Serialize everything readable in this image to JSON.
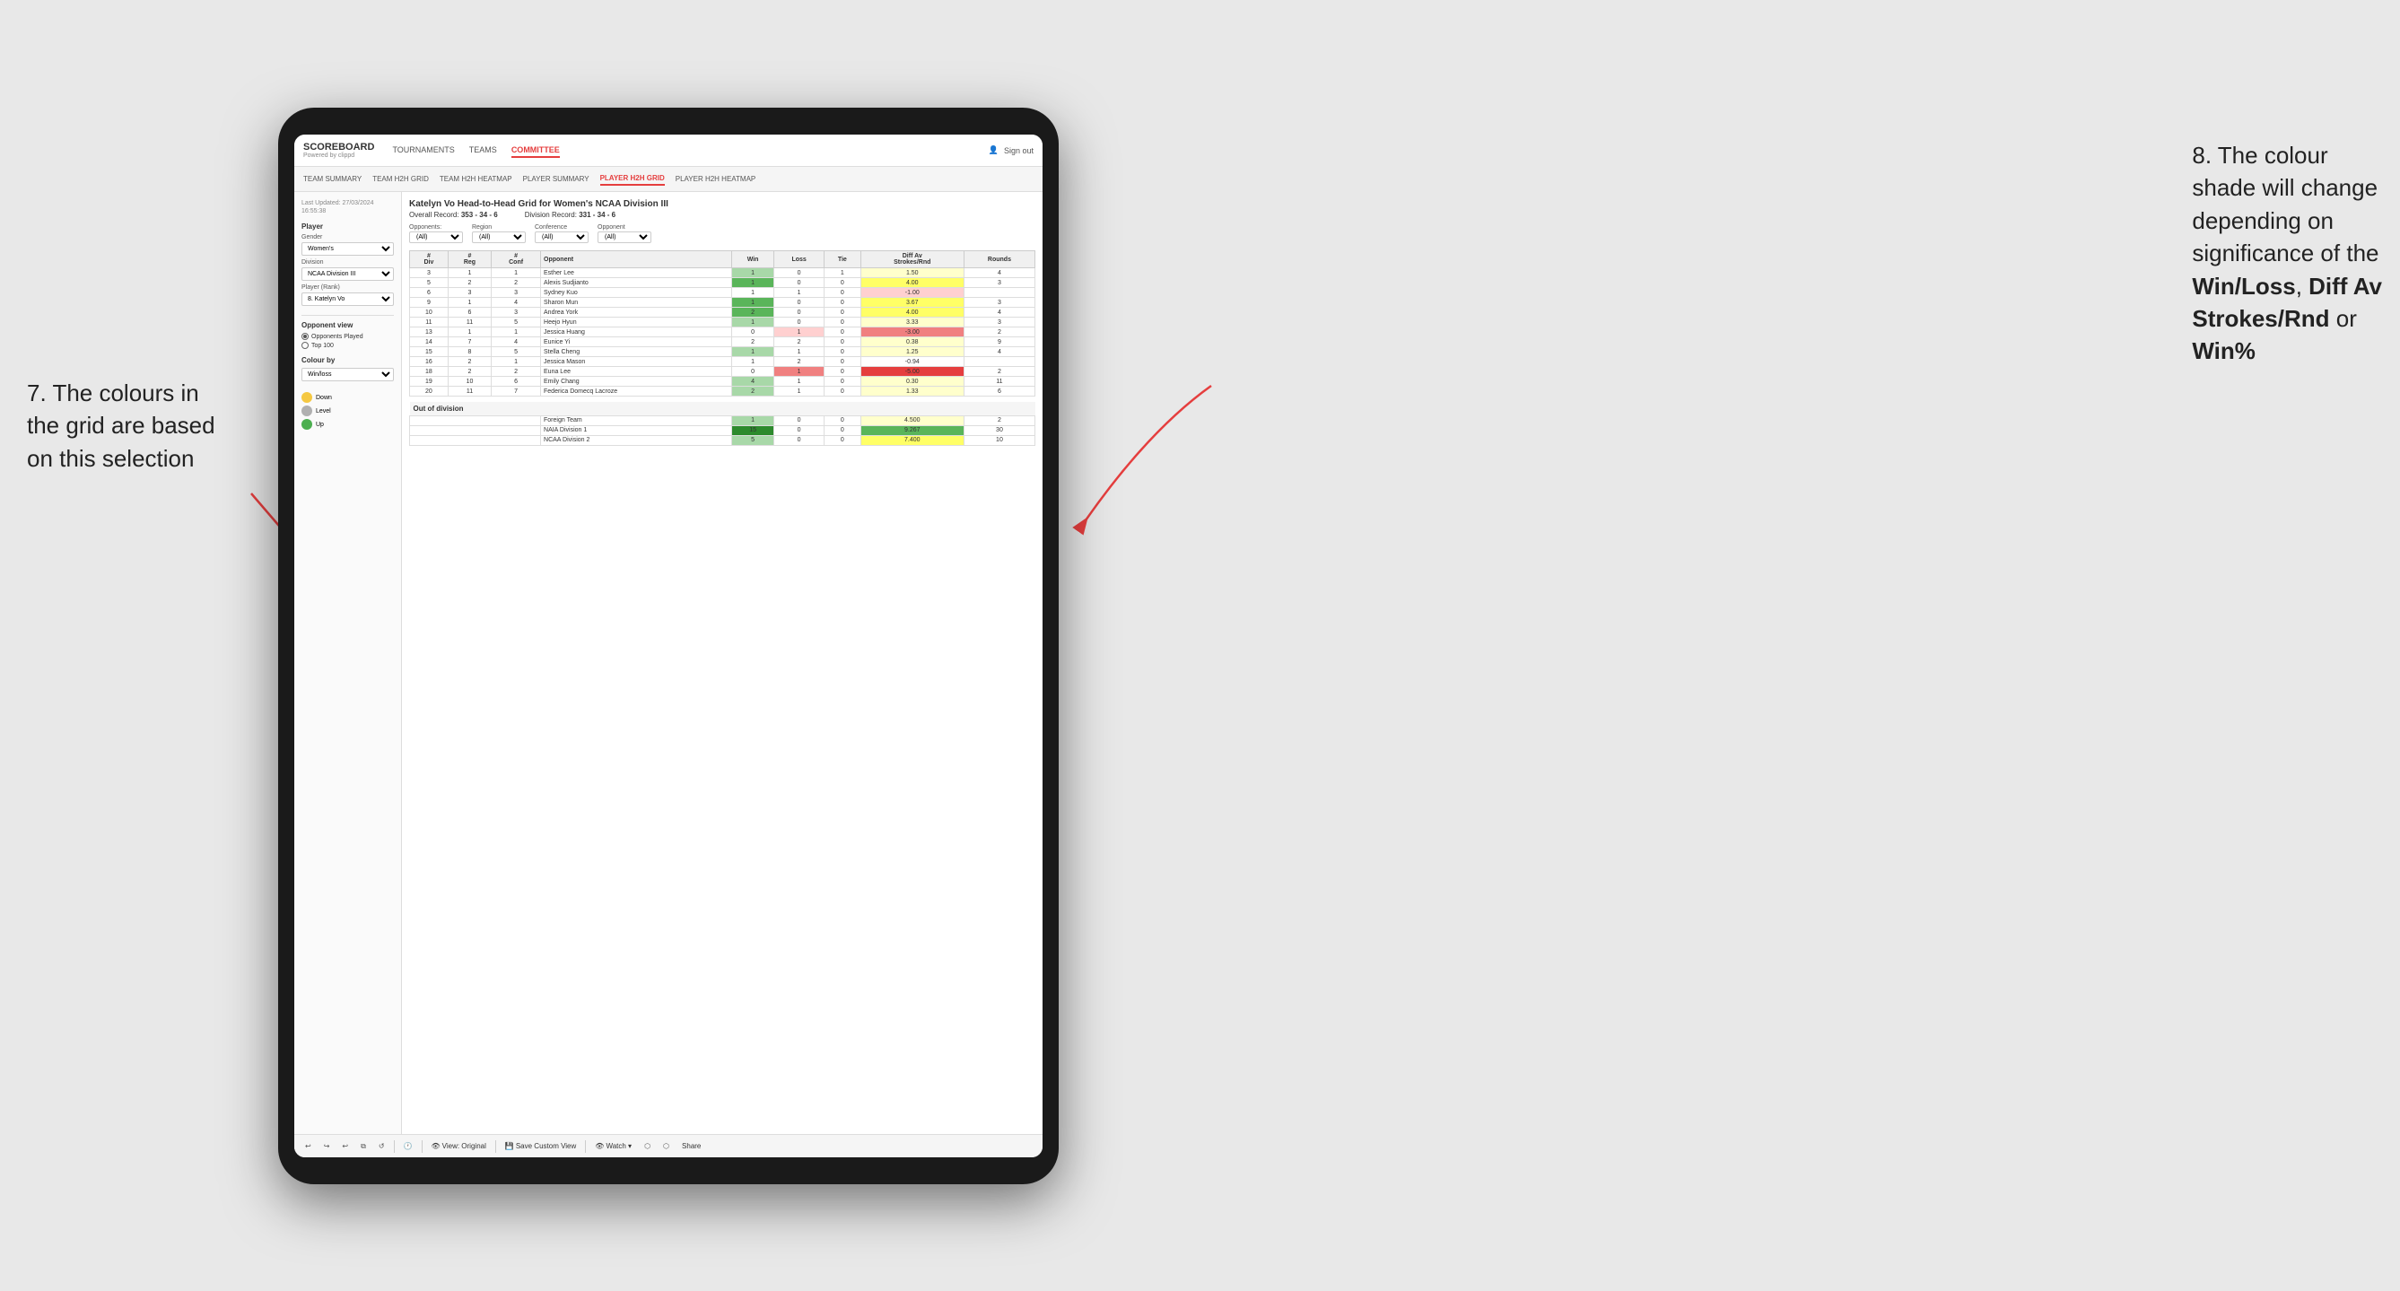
{
  "annotations": {
    "left": {
      "line1": "7. The colours in",
      "line2": "the grid are based",
      "line3": "on this selection"
    },
    "right": {
      "line1": "8. The colour",
      "line2": "shade will change",
      "line3": "depending on",
      "line4": "significance of the",
      "bold1": "Win/Loss",
      "comma1": ", ",
      "bold2": "Diff Av",
      "line5": "Strokes/Rnd",
      "or": " or",
      "bold3": "Win%"
    }
  },
  "header": {
    "logo": "SCOREBOARD",
    "logo_sub": "Powered by clippd",
    "nav": [
      "TOURNAMENTS",
      "TEAMS",
      "COMMITTEE"
    ],
    "active_nav": "COMMITTEE",
    "right_items": [
      "Sign out"
    ],
    "subnav": [
      "TEAM SUMMARY",
      "TEAM H2H GRID",
      "TEAM H2H HEATMAP",
      "PLAYER SUMMARY",
      "PLAYER H2H GRID",
      "PLAYER H2H HEATMAP"
    ],
    "active_subnav": "PLAYER H2H GRID"
  },
  "left_panel": {
    "last_updated": "Last Updated: 27/03/2024\n16:55:38",
    "player_label": "Player",
    "gender_label": "Gender",
    "gender_value": "Women's",
    "division_label": "Division",
    "division_value": "NCAA Division III",
    "player_rank_label": "Player (Rank)",
    "player_rank_value": "8. Katelyn Vo",
    "opponent_view_label": "Opponent view",
    "opponent_view_options": [
      "Opponents Played",
      "Top 100"
    ],
    "opponent_view_selected": "Opponents Played",
    "colour_by_label": "Colour by",
    "colour_by_value": "Win/loss",
    "legend": [
      {
        "label": "Down",
        "color": "#f5c842"
      },
      {
        "label": "Level",
        "color": "#b0b0b0"
      },
      {
        "label": "Up",
        "color": "#4caf50"
      }
    ]
  },
  "grid": {
    "title": "Katelyn Vo Head-to-Head Grid for Women's NCAA Division III",
    "overall_record_label": "Overall Record:",
    "overall_record_value": "353 - 34 - 6",
    "division_record_label": "Division Record:",
    "division_record_value": "331 - 34 - 6",
    "filter_labels": [
      "Opponents:",
      "Region",
      "Conference",
      "Opponent"
    ],
    "filter_values": [
      "(All)",
      "(All)",
      "(All)",
      "(All)"
    ],
    "columns": [
      "#\nDiv",
      "#\nReg",
      "#\nConf",
      "Opponent",
      "Win",
      "Loss",
      "Tie",
      "Diff Av\nStrokes/Rnd",
      "Rounds"
    ],
    "rows": [
      {
        "div": "3",
        "reg": "1",
        "conf": "1",
        "opponent": "Esther Lee",
        "win": 1,
        "loss": 0,
        "tie": 1,
        "diff": "1.50",
        "rounds": "4",
        "win_color": "win-light",
        "diff_color": "yellow-light"
      },
      {
        "div": "5",
        "reg": "2",
        "conf": "2",
        "opponent": "Alexis Sudjianto",
        "win": 1,
        "loss": 0,
        "tie": 0,
        "diff": "4.00",
        "rounds": "3",
        "win_color": "win-medium",
        "diff_color": "yellow-medium"
      },
      {
        "div": "6",
        "reg": "3",
        "conf": "3",
        "opponent": "Sydney Kuo",
        "win": 1,
        "loss": 1,
        "tie": 0,
        "diff": "-1.00",
        "rounds": "",
        "win_color": "neutral",
        "diff_color": "loss-light"
      },
      {
        "div": "9",
        "reg": "1",
        "conf": "4",
        "opponent": "Sharon Mun",
        "win": 1,
        "loss": 0,
        "tie": 0,
        "diff": "3.67",
        "rounds": "3",
        "win_color": "win-medium",
        "diff_color": "yellow-medium"
      },
      {
        "div": "10",
        "reg": "6",
        "conf": "3",
        "opponent": "Andrea York",
        "win": 2,
        "loss": 0,
        "tie": 0,
        "diff": "4.00",
        "rounds": "4",
        "win_color": "win-medium",
        "diff_color": "yellow-medium"
      },
      {
        "div": "11",
        "reg": "11",
        "conf": "5",
        "opponent": "Heejo Hyun",
        "win": 1,
        "loss": 0,
        "tie": 0,
        "diff": "3.33",
        "rounds": "3",
        "win_color": "win-light",
        "diff_color": "yellow-light"
      },
      {
        "div": "13",
        "reg": "1",
        "conf": "1",
        "opponent": "Jessica Huang",
        "win": 0,
        "loss": 1,
        "tie": 0,
        "diff": "-3.00",
        "rounds": "2",
        "win_color": "neutral",
        "diff_color": "loss-medium"
      },
      {
        "div": "14",
        "reg": "7",
        "conf": "4",
        "opponent": "Eunice Yi",
        "win": 2,
        "loss": 2,
        "tie": 0,
        "diff": "0.38",
        "rounds": "9",
        "win_color": "neutral",
        "diff_color": "yellow-light"
      },
      {
        "div": "15",
        "reg": "8",
        "conf": "5",
        "opponent": "Stella Cheng",
        "win": 1,
        "loss": 1,
        "tie": 0,
        "diff": "1.25",
        "rounds": "4",
        "win_color": "neutral",
        "diff_color": "yellow-light"
      },
      {
        "div": "16",
        "reg": "2",
        "conf": "1",
        "opponent": "Jessica Mason",
        "win": 1,
        "loss": 2,
        "tie": 0,
        "diff": "-0.94",
        "rounds": "",
        "win_color": "neutral",
        "diff_color": "neutral"
      },
      {
        "div": "18",
        "reg": "2",
        "conf": "2",
        "opponent": "Euna Lee",
        "win": 0,
        "loss": 1,
        "tie": 0,
        "diff": "-5.00",
        "rounds": "2",
        "win_color": "neutral",
        "diff_color": "loss-strong"
      },
      {
        "div": "19",
        "reg": "10",
        "conf": "6",
        "opponent": "Emily Chang",
        "win": 4,
        "loss": 1,
        "tie": 0,
        "diff": "0.30",
        "rounds": "11",
        "win_color": "win-light",
        "diff_color": "yellow-light"
      },
      {
        "div": "20",
        "reg": "11",
        "conf": "7",
        "opponent": "Federica Domecq Lacroze",
        "win": 2,
        "loss": 1,
        "tie": 0,
        "diff": "1.33",
        "rounds": "6",
        "win_color": "win-light",
        "diff_color": "yellow-light"
      }
    ],
    "out_of_division_label": "Out of division",
    "out_of_division_rows": [
      {
        "opponent": "Foreign Team",
        "win": 1,
        "loss": 0,
        "tie": 0,
        "diff": "4.500",
        "rounds": "2",
        "win_color": "win-light",
        "diff_color": "yellow-light"
      },
      {
        "opponent": "NAIA Division 1",
        "win": 15,
        "loss": 0,
        "tie": 0,
        "diff": "9.267",
        "rounds": "30",
        "win_color": "win-strong",
        "diff_color": "win-medium"
      },
      {
        "opponent": "NCAA Division 2",
        "win": 5,
        "loss": 0,
        "tie": 0,
        "diff": "7.400",
        "rounds": "10",
        "win_color": "win-light",
        "diff_color": "yellow-medium"
      }
    ]
  },
  "toolbar": {
    "undo": "↩",
    "redo": "↪",
    "view_original": "View: Original",
    "save_custom": "Save Custom View",
    "watch": "Watch ▾",
    "share": "Share"
  }
}
